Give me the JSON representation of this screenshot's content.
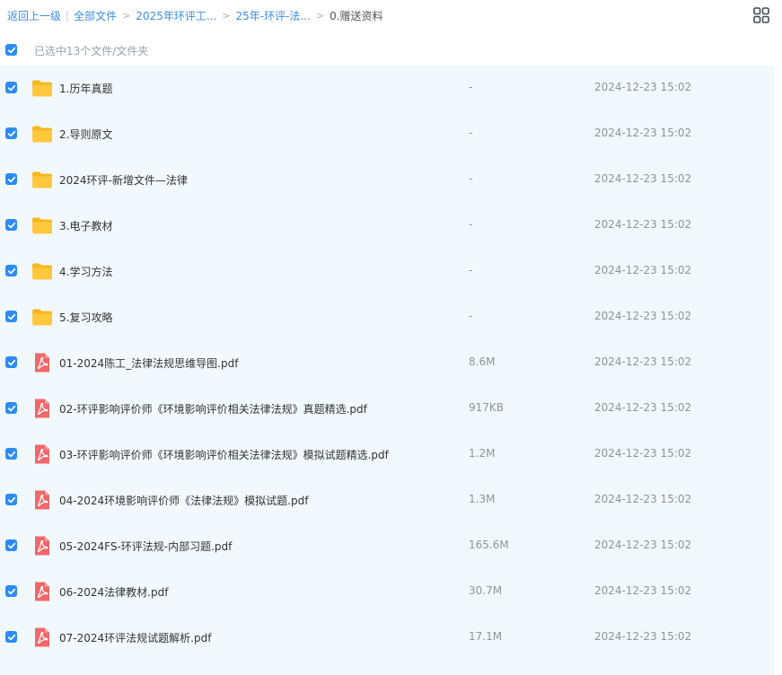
{
  "breadcrumb": {
    "back_label": "返回上一级",
    "separator": "|",
    "arrow": ">",
    "items": [
      "全部文件",
      "2025年环评工...",
      "25年-环评-法...",
      "0.赠送资料"
    ]
  },
  "toolbar": {
    "view_toggle_icon": "grid-view-icon"
  },
  "selection": {
    "checked": true,
    "label": "已选中13个文件/文件夹"
  },
  "colors": {
    "accent": "#2b8cf5",
    "list_bg": "#f1f8fe",
    "folder": "#ffc53d",
    "pdf": "#f0686a"
  },
  "files": [
    {
      "type": "folder",
      "icon": "folder-icon",
      "name": "1.历年真题",
      "size": "-",
      "date": "2024-12-23 15:02"
    },
    {
      "type": "folder",
      "icon": "folder-icon",
      "name": "2.导则原文",
      "size": "-",
      "date": "2024-12-23 15:02"
    },
    {
      "type": "folder",
      "icon": "folder-icon",
      "name": "2024环评-新增文件—法律",
      "size": "-",
      "date": "2024-12-23 15:02"
    },
    {
      "type": "folder",
      "icon": "folder-icon",
      "name": "3.电子教材",
      "size": "-",
      "date": "2024-12-23 15:02"
    },
    {
      "type": "folder",
      "icon": "folder-icon",
      "name": "4.学习方法",
      "size": "-",
      "date": "2024-12-23 15:02"
    },
    {
      "type": "folder",
      "icon": "folder-icon",
      "name": "5.复习攻略",
      "size": "-",
      "date": "2024-12-23 15:02"
    },
    {
      "type": "pdf",
      "icon": "pdf-icon",
      "name": "01-2024陈工_法律法规思维导图.pdf",
      "size": "8.6M",
      "date": "2024-12-23 15:02"
    },
    {
      "type": "pdf",
      "icon": "pdf-icon",
      "name": "02-环评影响评价师《环境影响评价相关法律法规》真题精选.pdf",
      "size": "917KB",
      "date": "2024-12-23 15:02"
    },
    {
      "type": "pdf",
      "icon": "pdf-icon",
      "name": "03-环评影响评价师《环境影响评价相关法律法规》模拟试题精选.pdf",
      "size": "1.2M",
      "date": "2024-12-23 15:02"
    },
    {
      "type": "pdf",
      "icon": "pdf-icon",
      "name": "04-2024环境影响评价师《法律法规》模拟试题.pdf",
      "size": "1.3M",
      "date": "2024-12-23 15:02"
    },
    {
      "type": "pdf",
      "icon": "pdf-icon",
      "name": "05-2024FS-环评法规-内部习题.pdf",
      "size": "165.6M",
      "date": "2024-12-23 15:02"
    },
    {
      "type": "pdf",
      "icon": "pdf-icon",
      "name": "06-2024法律教材.pdf",
      "size": "30.7M",
      "date": "2024-12-23 15:02"
    },
    {
      "type": "pdf",
      "icon": "pdf-icon",
      "name": "07-2024环评法规试题解析.pdf",
      "size": "17.1M",
      "date": "2024-12-23 15:02"
    }
  ]
}
